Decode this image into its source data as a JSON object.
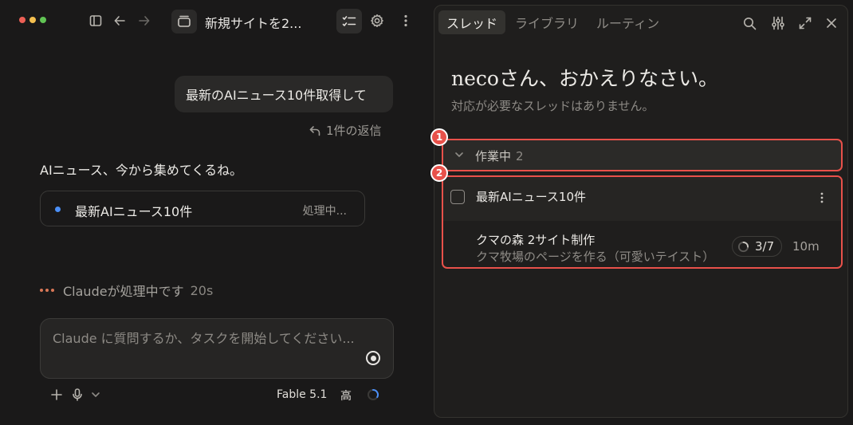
{
  "window": {
    "session_title": "新規サイトを2...",
    "traffic_lights": [
      "#ec5f55",
      "#f4bf4f",
      "#61c454"
    ]
  },
  "conversation": {
    "user_message": "最新のAIニュース10件取得して",
    "reply_count": "1件の返信",
    "assistant_message": "AIニュース、今から集めてくるね。",
    "task_card": {
      "name": "最新AIニュース10件",
      "status": "処理中..."
    },
    "processing": {
      "text": "Claudeが処理中です",
      "elapsed": "20s"
    }
  },
  "composer": {
    "placeholder": "Claude に質問するか、タスクを開始してください...",
    "model": "Fable 5.1",
    "effort": "高"
  },
  "panel": {
    "tabs": [
      {
        "label": "スレッド",
        "active": true
      },
      {
        "label": "ライブラリ",
        "active": false
      },
      {
        "label": "ルーティン",
        "active": false
      }
    ],
    "greeting": "necoさん、おかえりなさい。",
    "greeting_sub": "対応が必要なスレッドはありません。",
    "working_section": {
      "label": "作業中",
      "count": "2"
    },
    "threads": [
      {
        "title": "最新AIニュース10件"
      },
      {
        "title": "クマの森 2サイト制作",
        "subtitle": "クマ牧場のページを作る（可愛いテイスト）",
        "progress": "3/7",
        "time": "10m"
      }
    ]
  },
  "annotations": {
    "badge_1": "1",
    "badge_2": "2"
  },
  "colors": {
    "accent": "#d97757",
    "highlight": "#e8514a",
    "task_dot": "#4b8ff7"
  },
  "icons": [
    "sidebar-icon",
    "arrow-left-icon",
    "arrow-right-icon",
    "session-icon",
    "checklist-icon",
    "gear-icon",
    "more-vertical-icon",
    "reply-icon",
    "plus-icon",
    "mic-icon",
    "chevron-down-icon",
    "search-icon",
    "sliders-icon",
    "expand-icon",
    "close-icon"
  ]
}
